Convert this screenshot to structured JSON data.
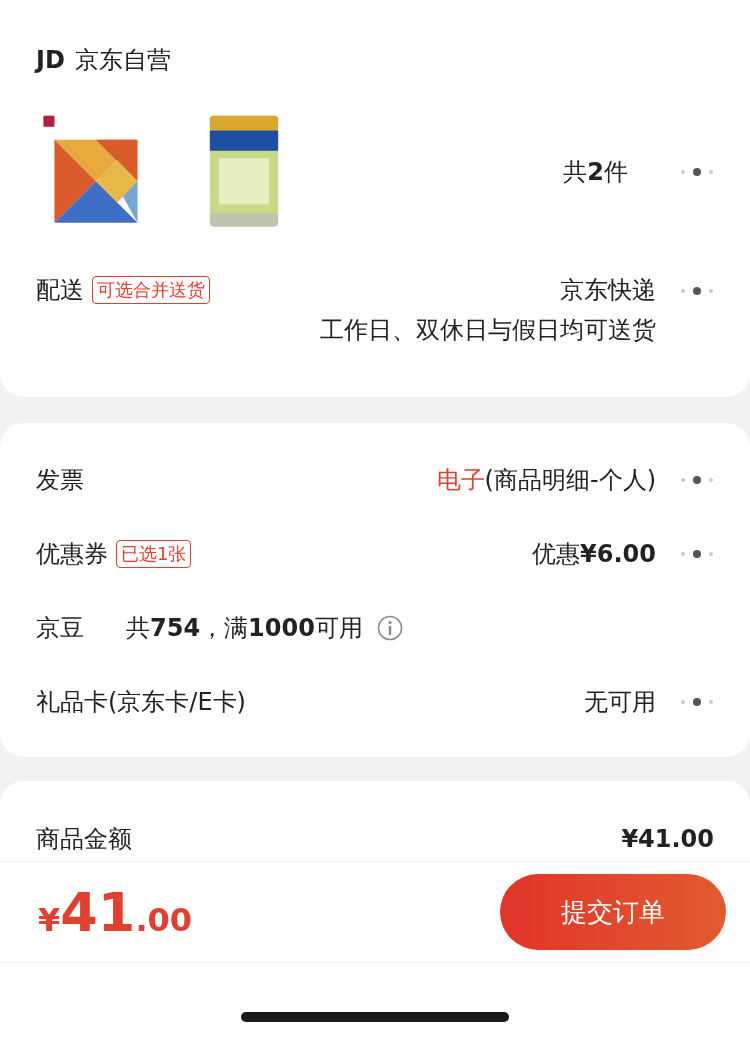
{
  "store": {
    "logo": "JD",
    "name": "京东自营"
  },
  "items": {
    "count": "共**2**件"
  },
  "delivery": {
    "label": "配送",
    "tag": "可选合并送货",
    "carrier": "京东快递",
    "note": "工作日、双休日与假日均可送货"
  },
  "options": [
    {
      "kind": "link",
      "label": "发票",
      "highlight": "电子",
      "value": "(商品明细-个人)"
    },
    {
      "kind": "link",
      "label": "优惠券",
      "tag": "已选1张",
      "value": "优惠**¥6.00**"
    },
    {
      "kind": "info",
      "label": "京豆",
      "value": "共**754**，满**1000**可用"
    },
    {
      "kind": "link",
      "label": "礼品卡(京东卡/E卡)",
      "value": "无可用"
    }
  ],
  "summary": {
    "label": "商品金额",
    "value": "¥41.00"
  },
  "footer": {
    "currency": "¥",
    "integer": "41",
    "decimals": ".00",
    "submit": "提交订单"
  }
}
